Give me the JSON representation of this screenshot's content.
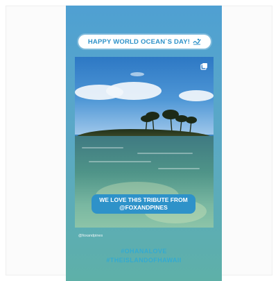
{
  "story": {
    "headline": "HAPPY WORLD OCEAN`S DAY!",
    "headline_icon": "wave-icon",
    "tribute_line1": "WE LOVE THIS TRIBUTE FROM",
    "tribute_line2": "@FOXANDPINES",
    "photo_credit": "@foxandpines",
    "hashtag1": "#OHANALOVE",
    "hashtag2": "#THEISLANDOFHAWAII"
  },
  "colors": {
    "accent_blue": "#2e92c9",
    "hashtag_blue": "#2aa9d9"
  }
}
